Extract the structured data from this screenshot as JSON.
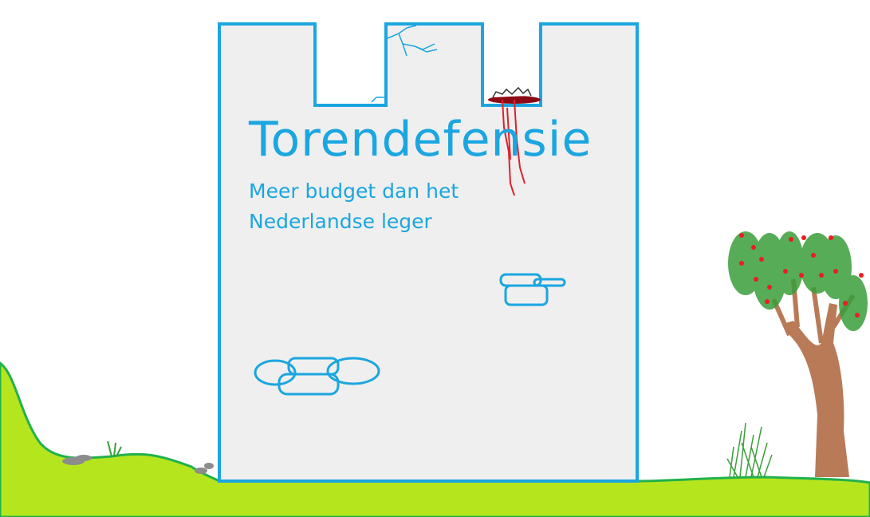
{
  "title": "Torendefensie",
  "subtitle_line1": "Meer budget dan het",
  "subtitle_line2": "Nederlandse leger",
  "colors": {
    "tower_outline": "#1ba6e0",
    "tower_fill": "#efefef",
    "grass": "#b5e61d",
    "grass_edge": "#22b14c",
    "blood": "#e0202a",
    "trunk": "#b97a57",
    "foliage": "#3a9e3a",
    "apples": "#ed1c24",
    "rocks": "#8c8c8c"
  }
}
